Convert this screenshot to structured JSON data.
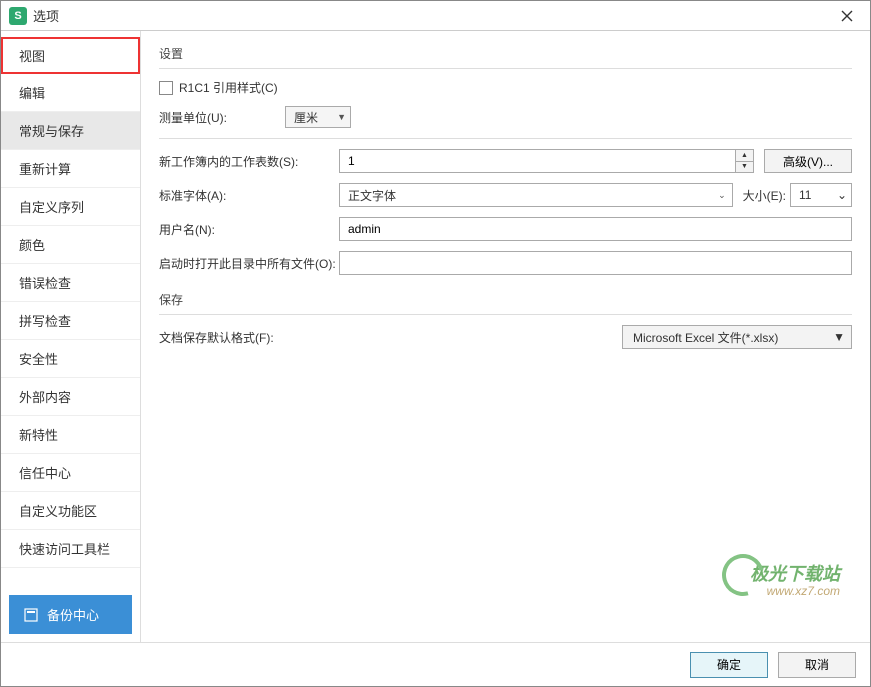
{
  "titlebar": {
    "icon_letter": "S",
    "title": "选项"
  },
  "sidebar": {
    "items": [
      {
        "label": "视图"
      },
      {
        "label": "编辑"
      },
      {
        "label": "常规与保存"
      },
      {
        "label": "重新计算"
      },
      {
        "label": "自定义序列"
      },
      {
        "label": "颜色"
      },
      {
        "label": "错误检查"
      },
      {
        "label": "拼写检查"
      },
      {
        "label": "安全性"
      },
      {
        "label": "外部内容"
      },
      {
        "label": "新特性"
      },
      {
        "label": "信任中心"
      },
      {
        "label": "自定义功能区"
      },
      {
        "label": "快速访问工具栏"
      }
    ],
    "backup_label": "备份中心"
  },
  "main": {
    "settings_heading": "设置",
    "r1c1_label": "R1C1 引用样式(C)",
    "unit_label": "测量单位(U):",
    "unit_value": "厘米",
    "sheets_label": "新工作簿内的工作表数(S):",
    "sheets_value": "1",
    "advanced_btn": "高级(V)...",
    "font_label": "标准字体(A):",
    "font_value": "正文字体",
    "size_label": "大小(E):",
    "size_value": "11",
    "username_label": "用户名(N):",
    "username_value": "admin",
    "startup_label": "启动时打开此目录中所有文件(O):",
    "startup_value": "",
    "save_heading": "保存",
    "save_format_label": "文档保存默认格式(F):",
    "save_format_value": "Microsoft Excel 文件(*.xlsx)"
  },
  "footer": {
    "ok": "确定",
    "cancel": "取消"
  },
  "watermark": {
    "line1": "极光下载站",
    "url": "www.xz7.com"
  }
}
